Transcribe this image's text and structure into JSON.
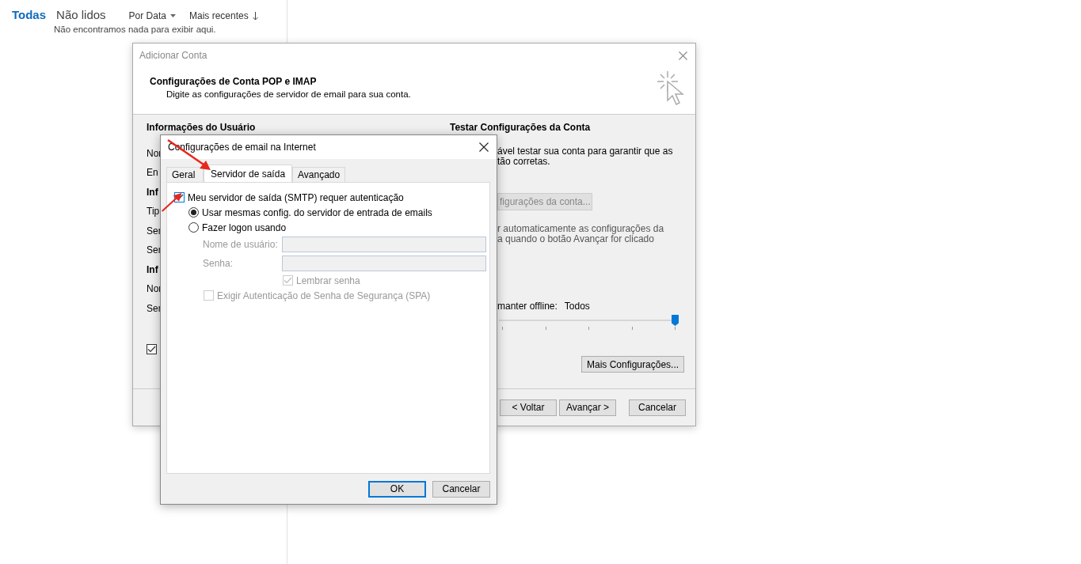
{
  "mail_list": {
    "filters": [
      {
        "label": "Todas",
        "selected": true
      },
      {
        "label": "Não lidos",
        "selected": false
      }
    ],
    "sort": [
      {
        "label": "Por Data",
        "kind": "caret"
      },
      {
        "label": "Mais recentes",
        "kind": "arrow"
      }
    ],
    "empty_message": "Não encontramos nada para exibir aqui."
  },
  "add_account_dialog": {
    "title": "Adicionar Conta",
    "header_title": "Configurações de Conta POP e IMAP",
    "header_subtitle": "Digite as configurações de servidor de email para sua conta.",
    "user_info": [
      {
        "kind": "heading",
        "text": "Informações do Usuário"
      },
      {
        "kind": "label",
        "text": "Nor"
      },
      {
        "kind": "label",
        "text": "En"
      },
      {
        "kind": "heading",
        "text": "Inf"
      },
      {
        "kind": "label",
        "text": "Tip"
      },
      {
        "kind": "label",
        "text": "Ser"
      },
      {
        "kind": "label",
        "text": "Ser"
      },
      {
        "kind": "heading",
        "text": "Inf"
      },
      {
        "kind": "label",
        "text": "Nor"
      },
      {
        "kind": "label",
        "text": "Ser"
      }
    ],
    "bottom_checkbox": {
      "checked": true
    },
    "test_heading": "Testar Configurações da Conta",
    "test_text": [
      "ável testar sua conta para garantir que as",
      "tão corretas."
    ],
    "test_button": {
      "label": "figurações da conta...",
      "disabled": true
    },
    "auto_test_text": [
      "r automaticamente as configurações da",
      "a quando o botão Avançar for clicado"
    ],
    "offline": {
      "label": "manter offline:",
      "value": "Todos",
      "level": 1
    },
    "more_button": "Mais Configurações...",
    "nav_buttons": [
      {
        "label": "< Voltar"
      },
      {
        "label": "Avançar >"
      },
      {
        "label": "Cancelar"
      }
    ]
  },
  "internet_dialog": {
    "title": "Configurações de email na Internet",
    "tabs": [
      {
        "label": "Geral",
        "selected": false
      },
      {
        "label": "Servidor de saída",
        "selected": true
      },
      {
        "label": "Avançado",
        "selected": false
      }
    ],
    "auth_checkbox": {
      "label": "Meu servidor de saída (SMTP) requer autenticação",
      "checked": true
    },
    "radios": [
      {
        "label": "Usar mesmas config. do servidor de entrada de emails",
        "selected": true
      },
      {
        "label": "Fazer logon usando",
        "selected": false
      }
    ],
    "fields": [
      {
        "label": "Nome de usuário:",
        "disabled": true
      },
      {
        "label": "Senha:",
        "disabled": true
      }
    ],
    "options": [
      {
        "label": "Lembrar senha",
        "checked": true,
        "disabled": true
      },
      {
        "label": "Exigir Autenticação de Senha de Segurança (SPA)",
        "checked": false,
        "disabled": true
      }
    ],
    "buttons": [
      {
        "label": "OK",
        "default": true
      },
      {
        "label": "Cancelar",
        "default": false
      }
    ]
  }
}
